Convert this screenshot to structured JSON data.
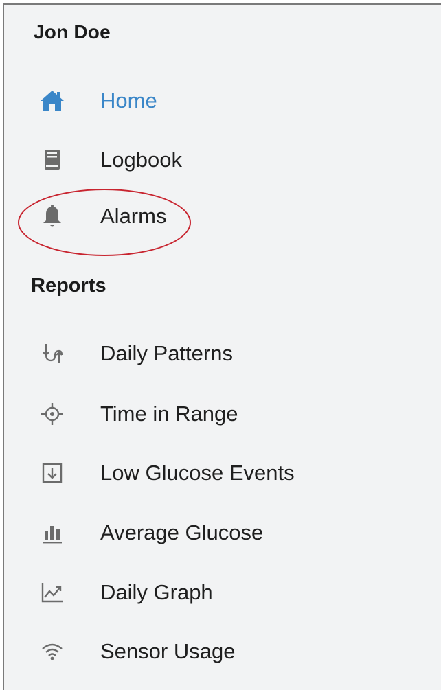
{
  "user": {
    "name": "Jon Doe"
  },
  "colors": {
    "active": "#3a86c8",
    "icon": "#6b6b6b",
    "annotation": "#c8242f"
  },
  "nav": {
    "items": [
      {
        "label": "Home",
        "icon": "home-icon",
        "active": true
      },
      {
        "label": "Logbook",
        "icon": "book-icon",
        "active": false
      },
      {
        "label": "Alarms",
        "icon": "bell-icon",
        "active": false
      }
    ]
  },
  "reports": {
    "title": "Reports",
    "items": [
      {
        "label": "Daily Patterns",
        "icon": "daily-patterns-icon"
      },
      {
        "label": "Time in Range",
        "icon": "crosshair-icon"
      },
      {
        "label": "Low Glucose Events",
        "icon": "download-box-icon"
      },
      {
        "label": "Average Glucose",
        "icon": "bar-chart-icon"
      },
      {
        "label": "Daily Graph",
        "icon": "line-chart-icon"
      },
      {
        "label": "Sensor Usage",
        "icon": "wifi-icon"
      }
    ]
  }
}
